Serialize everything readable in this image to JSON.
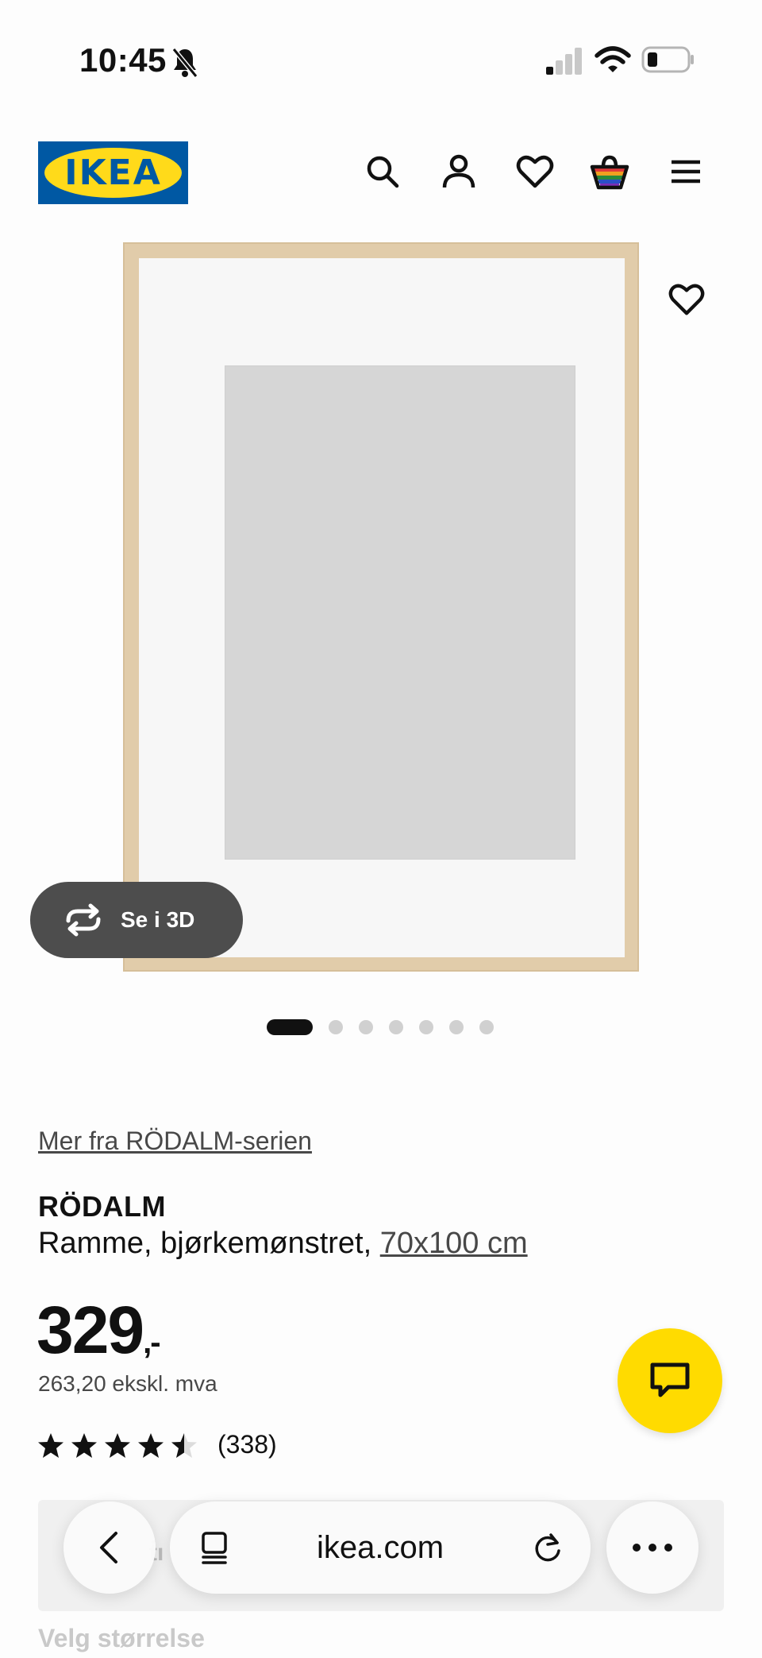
{
  "status_bar": {
    "time": "10:45",
    "icons": [
      "bell-slash-icon",
      "cellular-signal-icon",
      "wifi-icon",
      "battery-icon"
    ]
  },
  "header": {
    "logo_text": "IKEA",
    "icons": [
      "search-icon",
      "account-icon",
      "wishlist-heart-icon",
      "shopping-bag-icon",
      "menu-icon"
    ]
  },
  "gallery": {
    "view_3d_label": "Se i 3D",
    "image_count": 7,
    "active_index": 0
  },
  "product": {
    "series_link": "Mer fra RÖDALM-serien",
    "name": "RÖDALM",
    "description_prefix": "Ramme, bjørkemønstret, ",
    "size": "70x100 cm",
    "price": "329",
    "price_suffix": ",-",
    "price_ex_vat": "263,20 ekskl. mva",
    "rating": 4.5,
    "review_count": "(338)"
  },
  "below_fold": {
    "card_peek": "ṫı",
    "select_size_label": "Velg størrelse"
  },
  "browser": {
    "url": "ikea.com"
  },
  "colors": {
    "ikea_blue": "#0058a3",
    "ikea_yellow": "#ffdb00",
    "frame_birch": "#e1ccaa"
  }
}
